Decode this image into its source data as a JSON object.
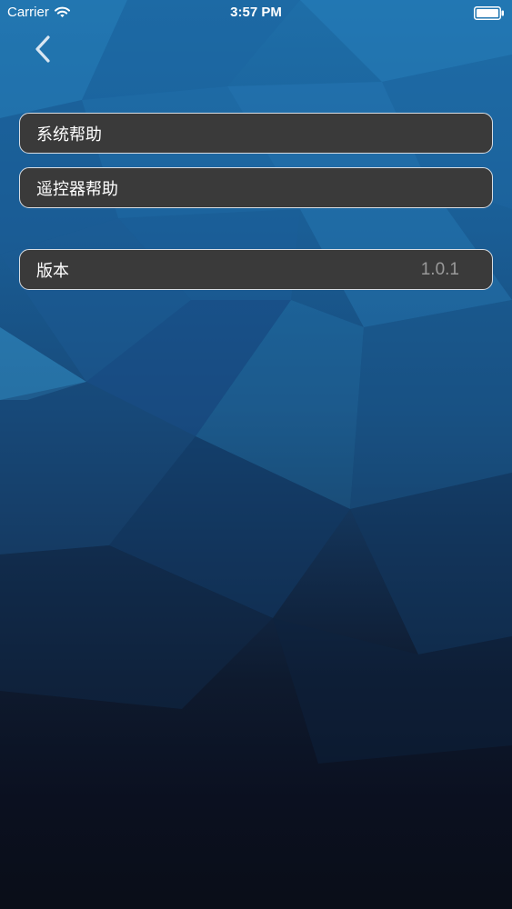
{
  "status_bar": {
    "carrier": "Carrier",
    "time": "3:57 PM",
    "icons": [
      "wifi-icon",
      "battery-icon"
    ]
  },
  "nav": {
    "back_icon": "chevron-left-icon"
  },
  "menu": {
    "system_help": "系统帮助",
    "remote_help": "遥控器帮助",
    "version_label": "版本",
    "version_value": "1.0.1"
  },
  "colors": {
    "item_background": "#3a3a3a",
    "item_border": "#d8dde3",
    "version_value_text": "#9a9a9a",
    "background_top": "#1e6ea8",
    "background_bottom": "#0a0e18"
  }
}
